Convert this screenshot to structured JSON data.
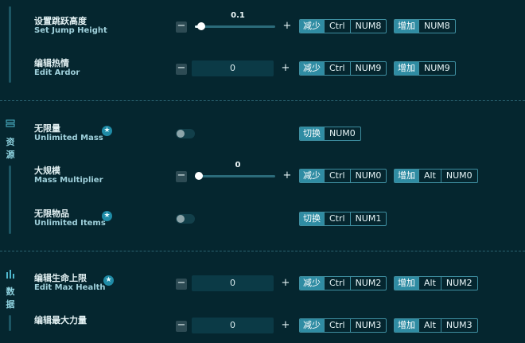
{
  "sections": {
    "resources": {
      "label": [
        "资",
        "源"
      ],
      "icon": "stack-icon"
    },
    "data": {
      "label": [
        "数",
        "据"
      ],
      "icon": "bar-chart-icon"
    }
  },
  "rows": [
    {
      "cn": "设置跳跃高度",
      "en": "Set Jump Height",
      "control": "slider",
      "value": "0.1",
      "fraction": 0.08,
      "keys": [
        {
          "lead": "减少",
          "keys": [
            "Ctrl",
            "NUM8"
          ]
        },
        {
          "lead": "增加",
          "keys": [
            "NUM8"
          ]
        }
      ]
    },
    {
      "cn": "编辑热情",
      "en": "Edit Ardor",
      "control": "number",
      "value": "0",
      "keys": [
        {
          "lead": "减少",
          "keys": [
            "Ctrl",
            "NUM9"
          ]
        },
        {
          "lead": "增加",
          "keys": [
            "NUM9"
          ]
        }
      ]
    },
    {
      "cn": "无限量",
      "en": "Unlimited Mass",
      "star": true,
      "control": "toggle",
      "on": false,
      "keys": [
        {
          "lead": "切换",
          "keys": [
            "NUM0"
          ]
        }
      ]
    },
    {
      "cn": "大规模",
      "en": "Mass Multiplier",
      "control": "slider",
      "value": "0",
      "fraction": 0.05,
      "keys": [
        {
          "lead": "减少",
          "keys": [
            "Ctrl",
            "NUM0"
          ]
        },
        {
          "lead": "增加",
          "keys": [
            "Alt",
            "NUM0"
          ]
        }
      ]
    },
    {
      "cn": "无限物品",
      "en": "Unlimited Items",
      "star": true,
      "control": "toggle",
      "on": false,
      "keys": [
        {
          "lead": "切换",
          "keys": [
            "Ctrl",
            "NUM1"
          ]
        }
      ]
    },
    {
      "cn": "编辑生命上限",
      "en": "Edit Max Health",
      "star": true,
      "control": "number",
      "value": "0",
      "keys": [
        {
          "lead": "减少",
          "keys": [
            "Ctrl",
            "NUM2"
          ]
        },
        {
          "lead": "增加",
          "keys": [
            "Alt",
            "NUM2"
          ]
        }
      ]
    },
    {
      "cn": "编辑最大力量",
      "en": "",
      "control": "number",
      "value": "0",
      "keys": [
        {
          "lead": "减少",
          "keys": [
            "Ctrl",
            "NUM3"
          ]
        },
        {
          "lead": "增加",
          "keys": [
            "Alt",
            "NUM3"
          ]
        }
      ]
    }
  ],
  "icons": {
    "minus": "−",
    "plus": "+",
    "star": "★"
  },
  "colors": {
    "background": "#05262f",
    "accent": "#2f8ca3",
    "key_border": "#3e8ea0"
  }
}
